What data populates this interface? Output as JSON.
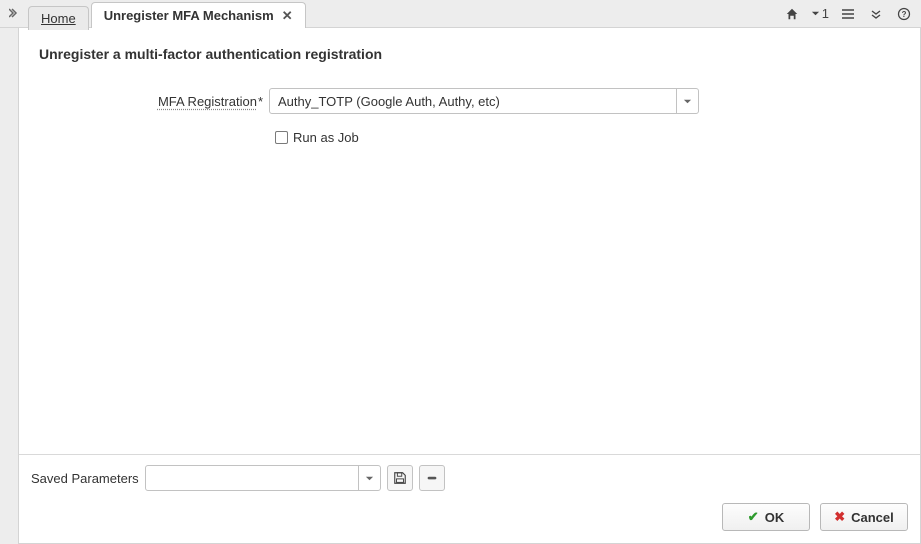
{
  "tabs": {
    "home": "Home",
    "current": "Unregister MFA Mechanism"
  },
  "toolbar": {
    "history_count": "1"
  },
  "page": {
    "title": "Unregister a multi-factor authentication registration",
    "mfa_label": "MFA Registration",
    "required_mark": "*",
    "mfa_value": "Authy_TOTP (Google Auth, Authy, etc)",
    "run_as_job": "Run as Job"
  },
  "footer": {
    "saved_parameters": "Saved Parameters",
    "ok": "OK",
    "cancel": "Cancel"
  }
}
